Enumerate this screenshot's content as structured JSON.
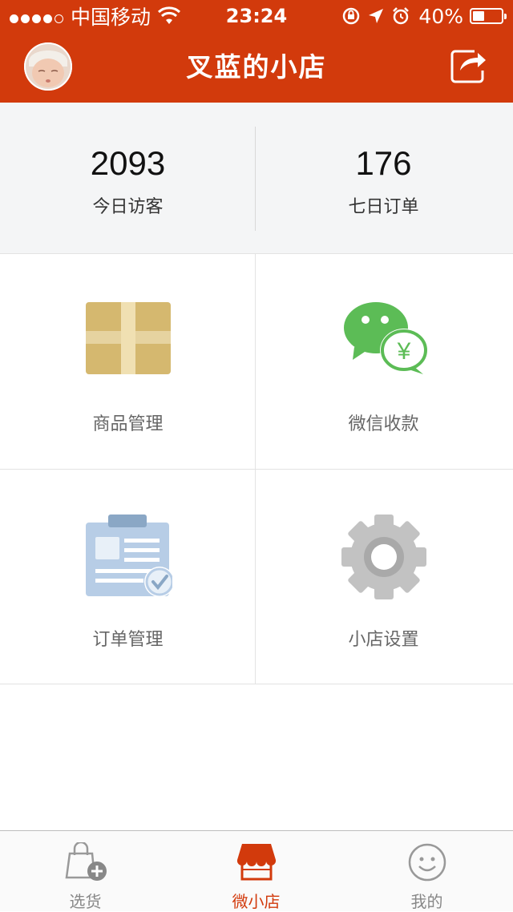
{
  "status_bar": {
    "carrier": "中国移动",
    "time": "23:24",
    "battery_percent": "40%",
    "battery_level": 0.4,
    "signal_bars": 4
  },
  "header": {
    "title": "叉蓝的小店",
    "avatar_icon": "baby-avatar",
    "share_icon": "share-icon"
  },
  "stats": [
    {
      "value": "2093",
      "label": "今日访客"
    },
    {
      "value": "176",
      "label": "七日订单"
    }
  ],
  "menu": [
    {
      "label": "商品管理",
      "icon": "package-icon"
    },
    {
      "label": "微信收款",
      "icon": "wechat-payment-icon"
    },
    {
      "label": "订单管理",
      "icon": "order-clipboard-icon"
    },
    {
      "label": "小店设置",
      "icon": "gear-icon"
    }
  ],
  "tabbar": [
    {
      "label": "选货",
      "icon": "shopping-bag-add-icon",
      "active": false
    },
    {
      "label": "微小店",
      "icon": "storefront-icon",
      "active": true
    },
    {
      "label": "我的",
      "icon": "smiley-icon",
      "active": false
    }
  ],
  "colors": {
    "brand": "#d23a0c",
    "stats_background": "#f4f5f6",
    "wechat_green": "#5cbc56"
  }
}
